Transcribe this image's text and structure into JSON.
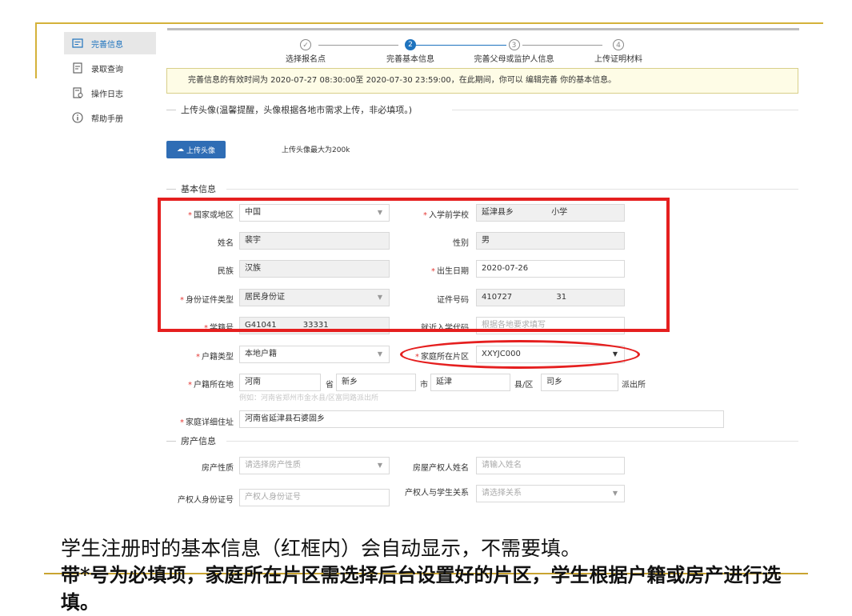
{
  "sidebar": {
    "items": [
      {
        "label": "完善信息",
        "icon": "edit-form-icon",
        "active": true
      },
      {
        "label": "录取查询",
        "icon": "document-search-icon",
        "active": false
      },
      {
        "label": "操作日志",
        "icon": "log-icon",
        "active": false
      },
      {
        "label": "帮助手册",
        "icon": "info-circle-icon",
        "active": false
      }
    ]
  },
  "steps": [
    {
      "number": "✓",
      "label": "选择报名点",
      "state": "done"
    },
    {
      "number": "2",
      "label": "完善基本信息",
      "state": "active"
    },
    {
      "number": "3",
      "label": "完善父母或监护人信息",
      "state": "todo"
    },
    {
      "number": "4",
      "label": "上传证明材料",
      "state": "todo"
    }
  ],
  "notice": "完善信息的有效时间为 2020-07-27 08:30:00至 2020-07-30 23:59:00，在此期间，你可以 编辑完善 你的基本信息。",
  "avatar_section": {
    "title": "上传头像(温馨提醒，头像根据各地市需求上传，非必填项。)",
    "button_label": "上传头像",
    "hint": "上传头像最大为200k"
  },
  "basic_section": {
    "title": "基本信息",
    "country_label": "国家或地区",
    "country_value": "中国",
    "school_label": "入学前学校",
    "school_value": "延津县乡",
    "school_value_suffix": "小学",
    "name_label": "姓名",
    "name_value": "裴宇",
    "gender_label": "性别",
    "gender_value": "男",
    "ethnicity_label": "民族",
    "ethnicity_value": "汉族",
    "birth_label": "出生日期",
    "birth_value": "2020-07-26",
    "idtype_label": "身份证件类型",
    "idtype_value": "居民身份证",
    "idnum_label": "证件号码",
    "idnum_value": "410727",
    "idnum_suffix": "31",
    "studentno_label": "学籍号",
    "studentno_value": "G41041",
    "studentno_suffix": "33331",
    "nearby_label": "就近入学代码",
    "nearby_placeholder": "根据各地要求填写",
    "hukou_type_label": "户籍类型",
    "hukou_type_value": "本地户籍",
    "district_label": "家庭所在片区",
    "district_value": "XXYJC000",
    "hukou_loc_label": "户籍所在地",
    "province_value": "河南",
    "province_unit": "省",
    "city_value": "新乡",
    "city_unit": "市",
    "county_value": "延津",
    "county_unit": "县/区",
    "station_value": "司乡",
    "station_unit": "派出所",
    "hukou_hint": "例如：河南省郑州市金水县/区富同路派出所",
    "address_label": "家庭详细住址",
    "address_value": "河南省延津县石婆固乡"
  },
  "property_section": {
    "title": "房产信息",
    "nature_label": "房产性质",
    "nature_placeholder": "请选择房产性质",
    "owner_label": "房屋产权人姓名",
    "owner_placeholder": "请输入姓名",
    "owner_id_label": "产权人身份证号",
    "owner_id_placeholder": "产权人身份证号",
    "relation_label": "产权人与学生关系",
    "relation_placeholder": "请选择关系"
  },
  "captions": {
    "line1": "学生注册时的基本信息（红框内）会自动显示，不需要填。",
    "line2": "带*号为必填项，家庭所在片区需选择后台设置好的片区，学生根据户籍或房产进行选填。"
  },
  "colors": {
    "accent": "#1e73be",
    "highlight": "#e51f1f",
    "notice_bg": "#fefce6",
    "slide_deco": "#d4b23a"
  }
}
